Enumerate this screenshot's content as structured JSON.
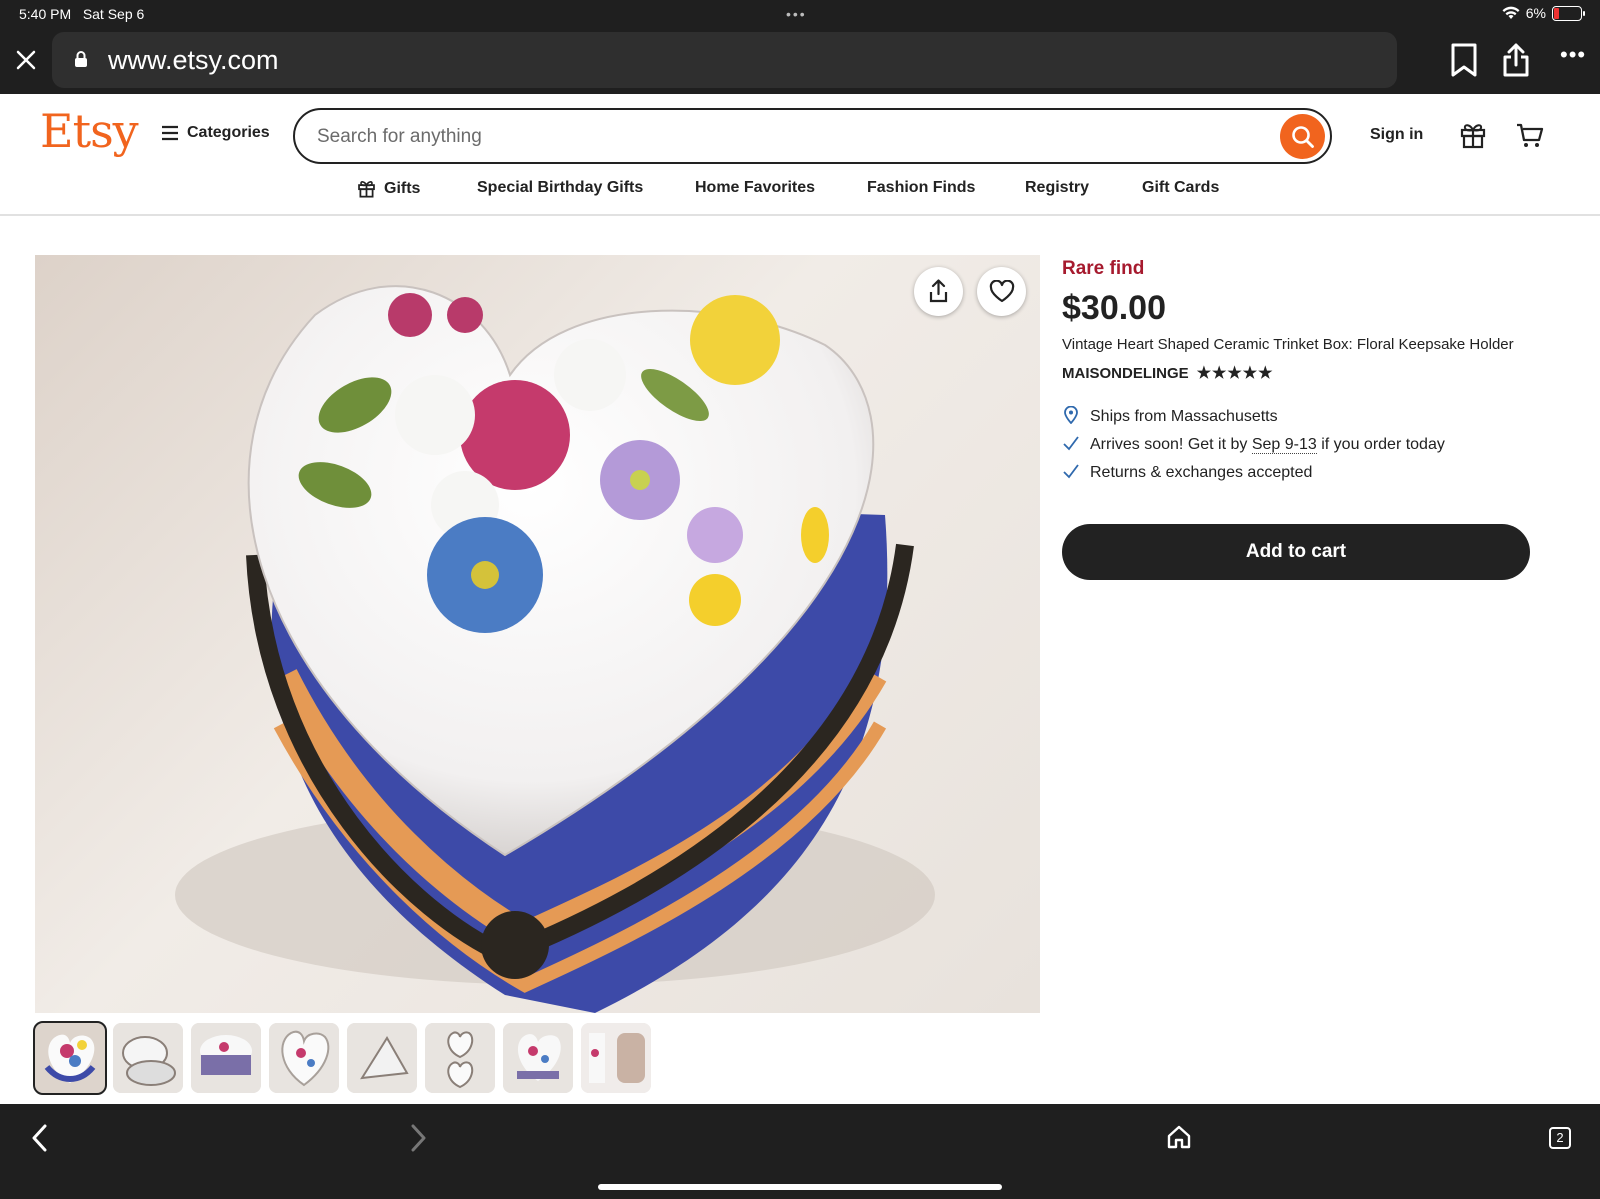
{
  "status_bar": {
    "time": "5:40 PM",
    "date": "Sat Sep 6",
    "battery": "6%",
    "battery_level": 0.06
  },
  "browser": {
    "url": "www.etsy.com",
    "tab_count": "2"
  },
  "header": {
    "logo": "Etsy",
    "categories_label": "Categories",
    "search_placeholder": "Search for anything",
    "sign_in": "Sign in"
  },
  "nav": {
    "items": [
      "Gifts",
      "Special Birthday Gifts",
      "Home Favorites",
      "Fashion Finds",
      "Registry",
      "Gift Cards"
    ]
  },
  "product": {
    "badge": "Rare find",
    "price": "$30.00",
    "title": "Vintage Heart Shaped Ceramic Trinket Box: Floral Keepsake Holder",
    "shop": "MAISONDELINGE",
    "rating": 5,
    "stars": "★★★★★",
    "ships_from": "Ships from Massachusetts",
    "arrives_prefix": "Arrives soon! Get it by ",
    "arrives_dates": "Sep 9-13",
    "arrives_suffix": " if you order today",
    "returns": "Returns & exchanges accepted",
    "add_to_cart": "Add to cart",
    "thumbnail_count": 8
  },
  "colors": {
    "brand": "#f1641e",
    "rare": "#a61a2e",
    "dark": "#222222"
  }
}
